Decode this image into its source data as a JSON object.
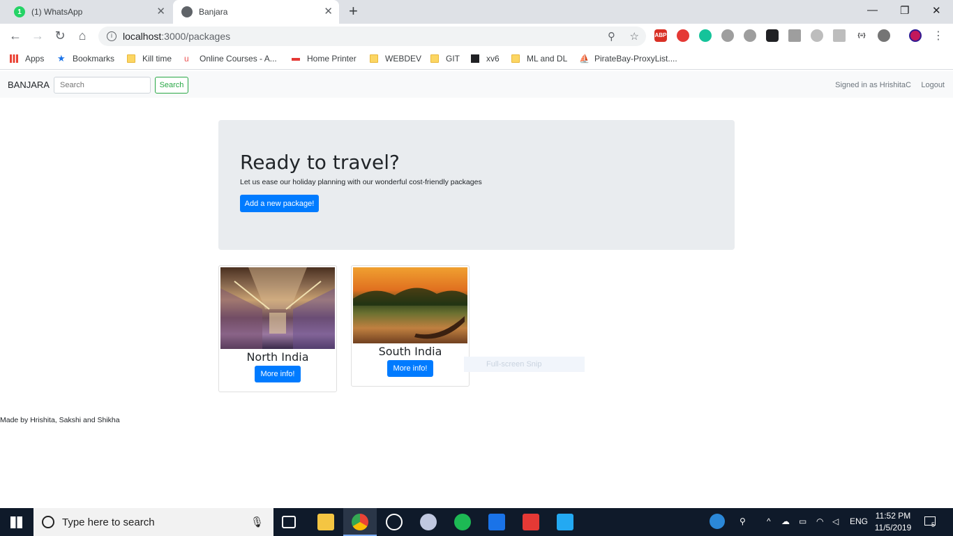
{
  "browser": {
    "tabs": [
      {
        "label": "(1) WhatsApp",
        "badge": "1"
      },
      {
        "label": "Banjara"
      }
    ],
    "url_host": "localhost",
    "url_path": ":3000/packages",
    "bookmarks": [
      "Apps",
      "Bookmarks",
      "Kill time",
      "Online Courses - A...",
      "Home Printer",
      "WEBDEV",
      "GIT",
      "xv6",
      "ML and DL",
      "PirateBay-ProxyList...."
    ],
    "extensions": [
      "ABP"
    ]
  },
  "navbar": {
    "brand": "BANJARA",
    "search_placeholder": "Search",
    "search_button": "Search",
    "signed_in": "Signed in as HrishitaC",
    "logout": "Logout"
  },
  "jumbotron": {
    "title": "Ready to travel?",
    "subtitle": "Let us ease our holiday planning with our wonderful cost-friendly packages",
    "add_button": "Add a new package!"
  },
  "packages": [
    {
      "title": "North India",
      "button": "More info!"
    },
    {
      "title": "South India",
      "button": "More info!"
    }
  ],
  "overlay": {
    "snip_label": "Full-screen Snip"
  },
  "footer": {
    "text": "Made by Hrishita, Sakshi and Shikha"
  },
  "taskbar": {
    "search_placeholder": "Type here to search",
    "lang": "ENG",
    "time": "11:52 PM",
    "date": "11/5/2019",
    "notifications": "5"
  }
}
